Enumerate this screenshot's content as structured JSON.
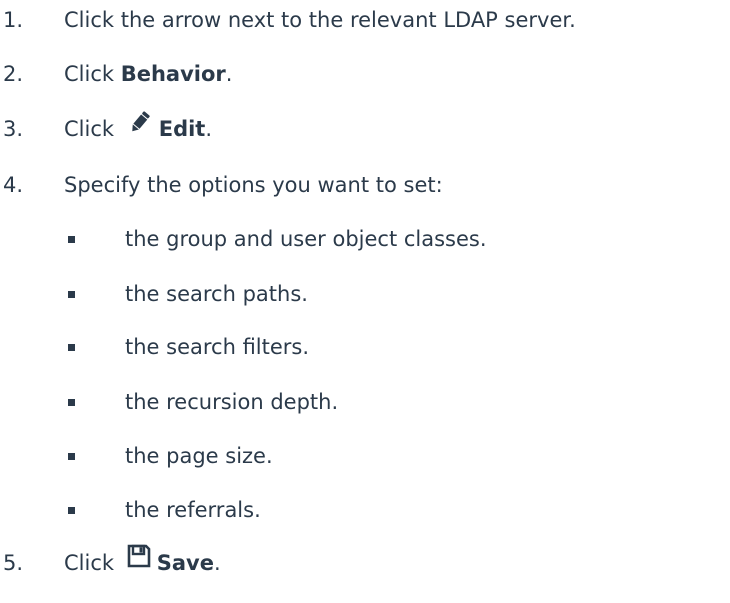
{
  "steps": [
    {
      "num": "1.",
      "text": "Click the arrow next to the relevant LDAP server."
    },
    {
      "num": "2.",
      "prefix": "Click ",
      "bold": "Behavior",
      "suffix": "."
    },
    {
      "num": "3.",
      "prefix": "Click ",
      "icon": "pencil-icon",
      "bold": "Edit",
      "suffix": "."
    },
    {
      "num": "4.",
      "text": "Specify the options you want to set:"
    },
    {
      "num": "5.",
      "prefix": "Click ",
      "icon": "floppy-disk-icon",
      "bold": "Save",
      "suffix": "."
    }
  ],
  "options": [
    "the group and user object classes.",
    "the search paths.",
    "the search filters.",
    "the recursion depth.",
    "the page size.",
    "the referrals."
  ],
  "colors": {
    "text": "#2b3a4a",
    "background": "#ffffff"
  }
}
